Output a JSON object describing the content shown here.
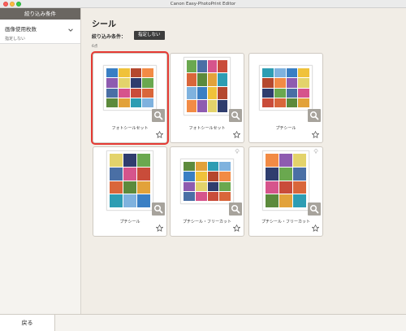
{
  "window": {
    "title": "Canon Easy-PhotoPrint Editor"
  },
  "sidebar": {
    "header": "絞り込み条件",
    "filter": {
      "label": "画像使用枚数",
      "value": "指定しない"
    }
  },
  "main": {
    "title": "シール",
    "condition_label": "絞り込み条件：",
    "condition_value": "指定しない",
    "count": "6点"
  },
  "cards": [
    {
      "label": "フォトシールセット",
      "layout": "landscape-4x4",
      "selected": true,
      "download_icon": false
    },
    {
      "label": "フォトシールセット",
      "layout": "portrait-4x4",
      "selected": false,
      "download_icon": false
    },
    {
      "label": "プチシール",
      "layout": "landscape-4x4",
      "selected": false,
      "download_icon": false
    },
    {
      "label": "プチシール",
      "layout": "portrait-3x4",
      "selected": false,
      "download_icon": false
    },
    {
      "label": "プチシール・フリーカット",
      "layout": "landscape-4x4",
      "selected": false,
      "download_icon": true
    },
    {
      "label": "プチシール・フリーカット",
      "layout": "portrait-3x4",
      "selected": false,
      "download_icon": true
    }
  ],
  "footer": {
    "back_label": "戻る"
  },
  "colors": {
    "selection": "#e53a34",
    "sidebar_header": "#6a6661",
    "badge": "#3d3d3d",
    "background": "#f1ede6"
  }
}
